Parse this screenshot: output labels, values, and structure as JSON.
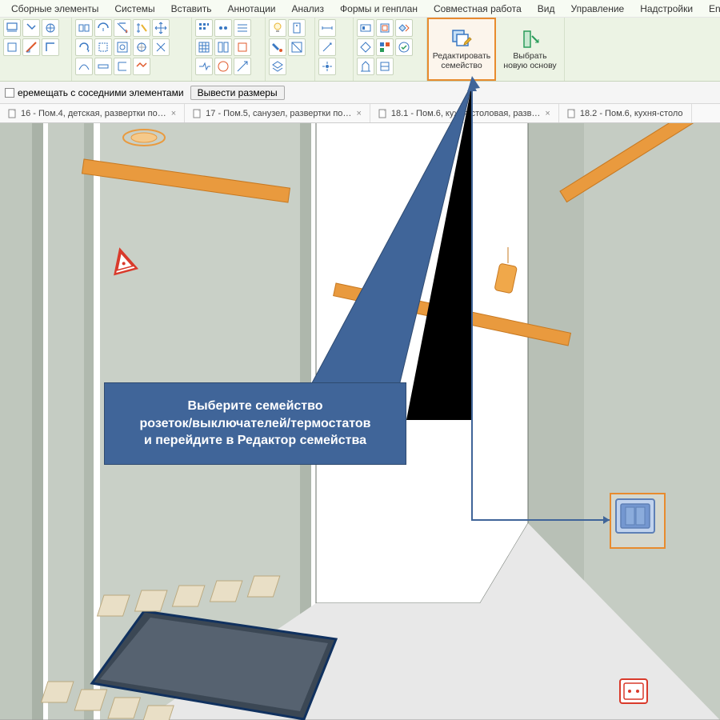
{
  "menu": {
    "items": [
      "Сборные элементы",
      "Системы",
      "Вставить",
      "Аннотации",
      "Анализ",
      "Формы и генплан",
      "Совместная работа",
      "Вид",
      "Управление",
      "Надстройки",
      "Ensc"
    ]
  },
  "ribbon": {
    "edit_family": {
      "line1": "Редактировать",
      "line2": "семейство"
    },
    "new_host": {
      "line1": "Выбрать",
      "line2": "новую основу"
    }
  },
  "optbar": {
    "checkbox_label": "еремещать с соседними элементами",
    "button_label": "Вывести размеры"
  },
  "tabs": [
    {
      "label": "16 - Пом.4, детская, развертки по…"
    },
    {
      "label": "17 - Пом.5, санузел, развертки по…"
    },
    {
      "label": "18.1 - Пом.6, кухня-столовая, разв…"
    },
    {
      "label": "18.2 - Пом.6, кухня-столо"
    }
  ],
  "callout": {
    "line1": "Выберите семейство",
    "line2": "розеток/выключателей/термостатов",
    "line3": "и перейдите в Редактор семейства"
  }
}
